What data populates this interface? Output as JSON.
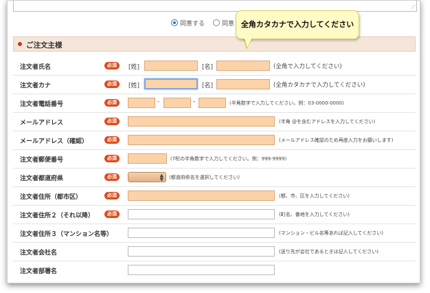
{
  "agreement": {
    "agree_label": "同意する",
    "disagree_label": "同意し",
    "selected": "agree"
  },
  "tooltip": {
    "text": "全角カタカナで入力してください"
  },
  "section": {
    "title": "ご注文主様"
  },
  "required_label": "必須",
  "rows": [
    {
      "label": "注文者氏名",
      "required": true,
      "tag_last": "[姓]",
      "tag_first": "[名]",
      "hint": "(全角で入力してください)"
    },
    {
      "label": "注文者カナ",
      "required": true,
      "tag_last": "[姓]",
      "tag_first": "[名]",
      "hint": "(全角カタカナで入力してください)"
    },
    {
      "label": "注文者電話番号",
      "required": true,
      "dash": "-",
      "hint": "(半角数字で入力してください。例：03-0000-0000)"
    },
    {
      "label": "メールアドレス",
      "required": true,
      "hint": "(半角 @を含むアドレスを入力してください)"
    },
    {
      "label": "メールアドレス（確認）",
      "required": true,
      "hint": "(メールアドレス確認のため再度入力をお願いします)"
    },
    {
      "label": "注文者郵便番号",
      "required": true,
      "hint": "(7桁の半角数字で入力してください。例：999-9999)"
    },
    {
      "label": "注文者都道府県",
      "required": true,
      "hint": "(都道府県名を選択してください)"
    },
    {
      "label": "注文者住所（都市区）",
      "required": true,
      "hint": "(都、市、区を入力してください)"
    },
    {
      "label": "注文者住所２（それ以降）",
      "required": true,
      "hint": "(町名、番地を入力してください)"
    },
    {
      "label": "注文者住所３（マンション名等）",
      "required": false,
      "hint": "(マンション・ビル名等あれば記入してください)"
    },
    {
      "label": "注文者会社名",
      "required": false,
      "hint": "(送り先が会社であるときは記入してください)"
    },
    {
      "label": "注文者部署名",
      "required": false,
      "hint": ""
    }
  ],
  "colors": {
    "required_badge": "#e04a1a",
    "field_fill": "#fcd3a8",
    "section_bg": "#f6e6da",
    "focus_ring": "#7ea6df"
  }
}
